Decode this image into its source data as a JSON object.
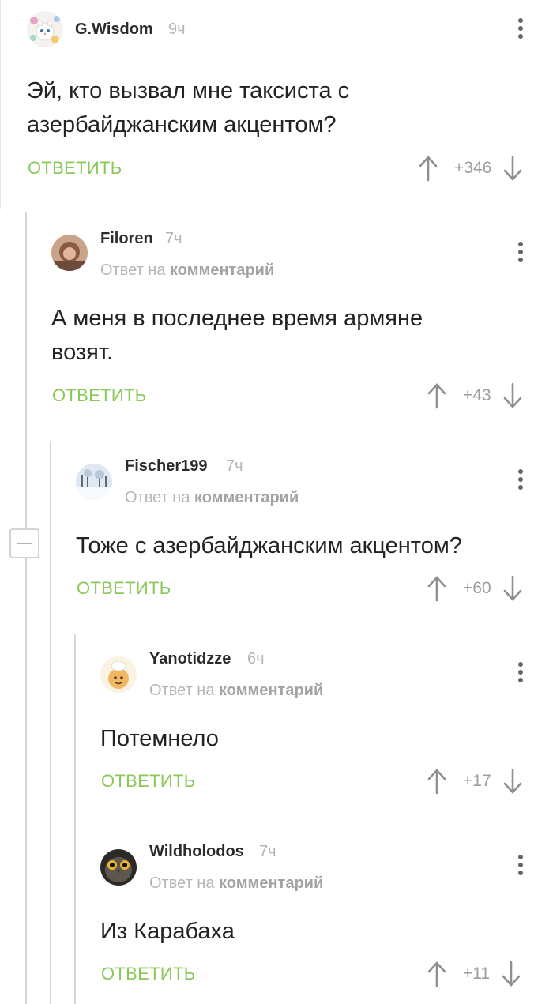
{
  "comments": [
    {
      "author": "G.Wisdom",
      "time": "9ч",
      "text": "Эй, кто вызвал мне таксиста с азербайджанским акцентом?",
      "reply_label": "ОТВЕТИТЬ",
      "rating": "+346"
    },
    {
      "author": "Filoren",
      "time": "7ч",
      "reply_prefix": "Ответ на",
      "reply_link": "комментарий",
      "text": "А меня в последнее время армяне возят.",
      "reply_label": "ОТВЕТИТЬ",
      "rating": "+43"
    },
    {
      "author": "Fischer199",
      "time": "7ч",
      "reply_prefix": "Ответ на",
      "reply_link": "комментарий",
      "text": "Тоже с азербайджанским акцентом?",
      "reply_label": "ОТВЕТИТЬ",
      "rating": "+60"
    },
    {
      "author": "Yanotidzze",
      "time": "6ч",
      "reply_prefix": "Ответ на",
      "reply_link": "комментарий",
      "text": "Потемнело",
      "reply_label": "ОТВЕТИТЬ",
      "rating": "+17"
    },
    {
      "author": "Wildholodos",
      "time": "7ч",
      "reply_prefix": "Ответ на",
      "reply_link": "комментарий",
      "text": "Из Карабаха",
      "reply_label": "ОТВЕТИТЬ",
      "rating": "+11"
    }
  ],
  "colors": {
    "reply_green": "#8ac858",
    "muted_gray": "#b5b5b5",
    "thread_line": "#d6d6d6"
  },
  "icons": {
    "upvote": "arrow-up-icon",
    "downvote": "arrow-down-icon",
    "menu": "more-vertical-icon",
    "collapse": "minus-square-icon"
  }
}
